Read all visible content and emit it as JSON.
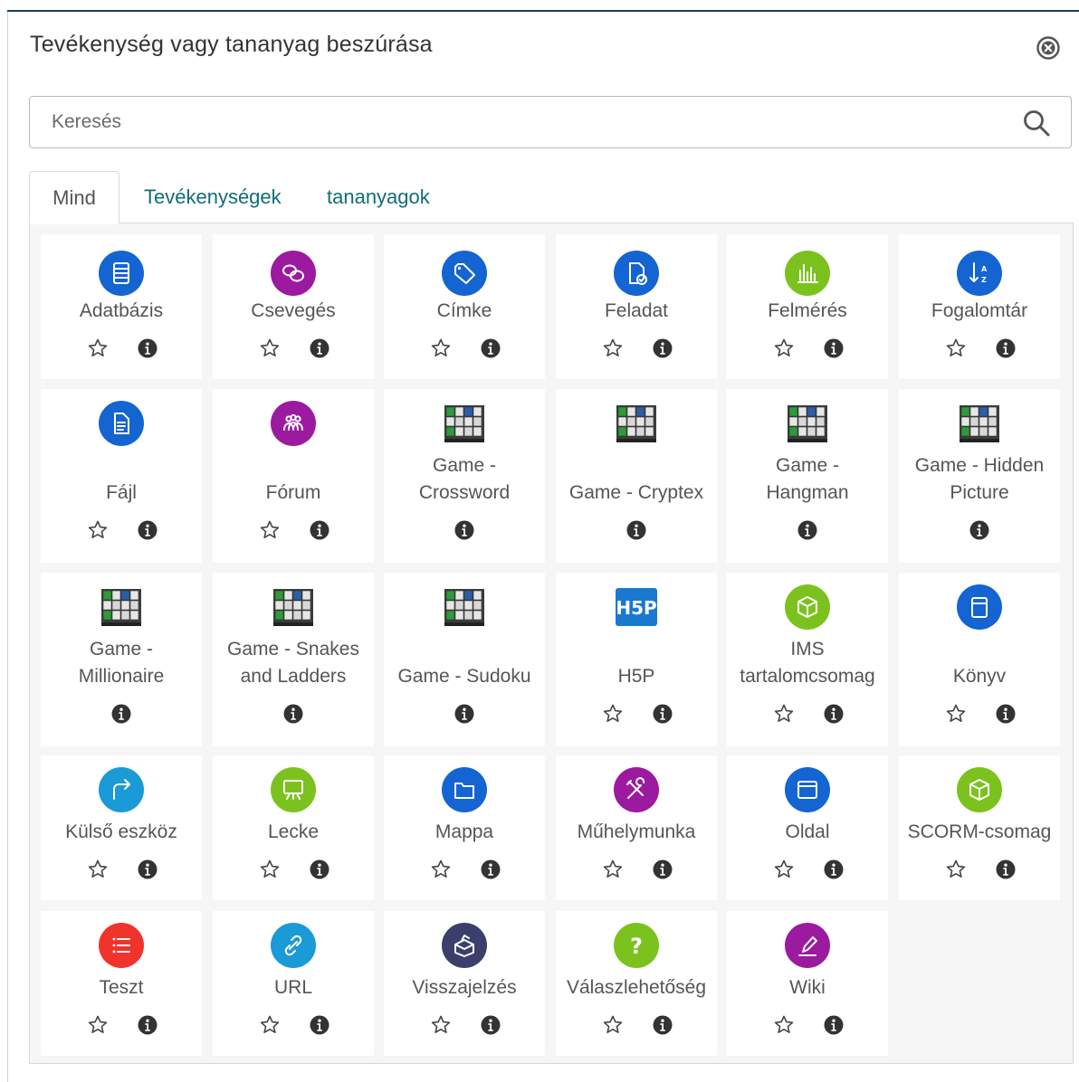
{
  "modal": {
    "title": "Tevékenység vagy tananyag beszúrása",
    "close_icon": "close-circle-icon"
  },
  "search": {
    "placeholder": "Keresés",
    "value": "",
    "icon": "search-icon"
  },
  "tabs": [
    {
      "label": "Mind",
      "active": true
    },
    {
      "label": "Tevékenységek",
      "active": false
    },
    {
      "label": "tananyagok",
      "active": false
    }
  ],
  "colors": {
    "accent_text": "#0f6e74",
    "blue": "#1464d2",
    "purple": "#9b1aa0",
    "green": "#7cc21e",
    "cyan": "#1a9ad6",
    "red": "#f0342c",
    "navy": "#3b3f6b"
  },
  "items": [
    [
      {
        "label": "Adatbázis",
        "icon": "database-icon",
        "color": "#1464d2",
        "star": true
      },
      {
        "label": "Csevegés",
        "icon": "chat-icon",
        "color": "#9b1aa0",
        "star": true
      },
      {
        "label": "Címke",
        "icon": "tag-icon",
        "color": "#1464d2",
        "star": true
      },
      {
        "label": "Feladat",
        "icon": "assignment-icon",
        "color": "#1464d2",
        "star": true
      },
      {
        "label": "Felmérés",
        "icon": "survey-chart-icon",
        "color": "#7cc21e",
        "star": true
      },
      {
        "label": "Fogalomtár",
        "icon": "glossary-sort-icon",
        "color": "#1464d2",
        "star": true
      }
    ],
    [
      {
        "label": "Fájl",
        "icon": "file-icon",
        "color": "#1464d2",
        "star": true
      },
      {
        "label": "Fórum",
        "icon": "forum-people-icon",
        "color": "#9b1aa0",
        "star": true
      },
      {
        "label": "Game - Crossword",
        "icon": "game-board-icon",
        "star": false
      },
      {
        "label": "Game - Cryptex",
        "icon": "game-board-icon",
        "star": false
      },
      {
        "label": "Game - Hangman",
        "icon": "game-board-icon",
        "star": false
      },
      {
        "label": "Game - Hidden Picture",
        "icon": "game-board-icon",
        "star": false
      }
    ],
    [
      {
        "label": "Game - Millionaire",
        "icon": "game-board-icon",
        "star": false
      },
      {
        "label": "Game - Snakes and Ladders",
        "icon": "game-board-icon",
        "star": false
      },
      {
        "label": "Game - Sudoku",
        "icon": "game-board-icon",
        "star": false
      },
      {
        "label": "H5P",
        "icon": "h5p-logo-icon",
        "star": true
      },
      {
        "label": "IMS tartalomcsomag",
        "icon": "package-cube-icon",
        "color": "#7cc21e",
        "star": true
      },
      {
        "label": "Könyv",
        "icon": "book-icon",
        "color": "#1464d2",
        "star": true
      }
    ],
    [
      {
        "label": "Külső eszköz",
        "icon": "external-tool-icon",
        "color": "#1a9ad6",
        "star": true
      },
      {
        "label": "Lecke",
        "icon": "lesson-board-icon",
        "color": "#7cc21e",
        "star": true
      },
      {
        "label": "Mappa",
        "icon": "folder-icon",
        "color": "#1464d2",
        "star": true
      },
      {
        "label": "Műhelymunka",
        "icon": "workshop-tools-icon",
        "color": "#9b1aa0",
        "star": true
      },
      {
        "label": "Oldal",
        "icon": "page-window-icon",
        "color": "#1464d2",
        "star": true
      },
      {
        "label": "SCORM-csomag",
        "icon": "package-cube-icon",
        "color": "#7cc21e",
        "star": true
      }
    ],
    [
      {
        "label": "Teszt",
        "icon": "quiz-list-icon",
        "color": "#f0342c",
        "star": true
      },
      {
        "label": "URL",
        "icon": "link-icon",
        "color": "#1a9ad6",
        "star": true
      },
      {
        "label": "Visszajelzés",
        "icon": "feedback-box-icon",
        "color": "#3b3f6b",
        "star": true
      },
      {
        "label": "Válaszlehetőség",
        "icon": "question-icon",
        "color": "#7cc21e",
        "star": true
      },
      {
        "label": "Wiki",
        "icon": "wiki-pen-icon",
        "color": "#9b1aa0",
        "star": true
      }
    ]
  ]
}
